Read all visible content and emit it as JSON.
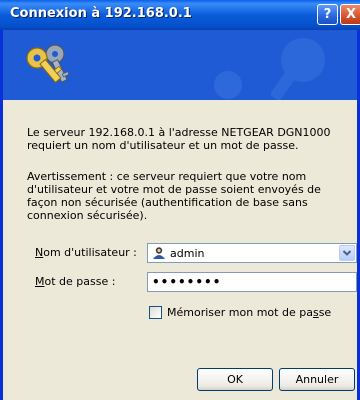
{
  "window": {
    "title": "Connexion à 192.168.0.1",
    "help_label": "?",
    "close_label": "X"
  },
  "message": "Le serveur 192.168.0.1 à l'adresse NETGEAR DGN1000 requiert un nom d'utilisateur et un mot de passe.",
  "warning": "Avertissement : ce serveur requiert que votre nom d'utilisateur et votre mot de passe soient envoyés de façon non sécurisée (authentification de base sans connexion sécurisée).",
  "form": {
    "username": {
      "label_underlined": "N",
      "label_rest": "om d'utilisateur :",
      "value": "admin"
    },
    "password": {
      "label_underlined": "M",
      "label_rest": "ot de passe :",
      "value": "••••••••"
    },
    "remember": {
      "label_before": "Mémoriser mon mot de pa",
      "label_underlined": "s",
      "label_after": "se",
      "checked": false
    }
  },
  "buttons": {
    "ok": "OK",
    "cancel": "Annuler"
  },
  "colors": {
    "title_bar": "#0b5cd9",
    "banner": "#1e5bd4",
    "dialog_bg": "#ece9d8",
    "frame": "#0831d9"
  },
  "icons": {
    "banner": "keys-icon",
    "username_field": "user-icon",
    "username_dropdown": "chevron-down-icon"
  }
}
